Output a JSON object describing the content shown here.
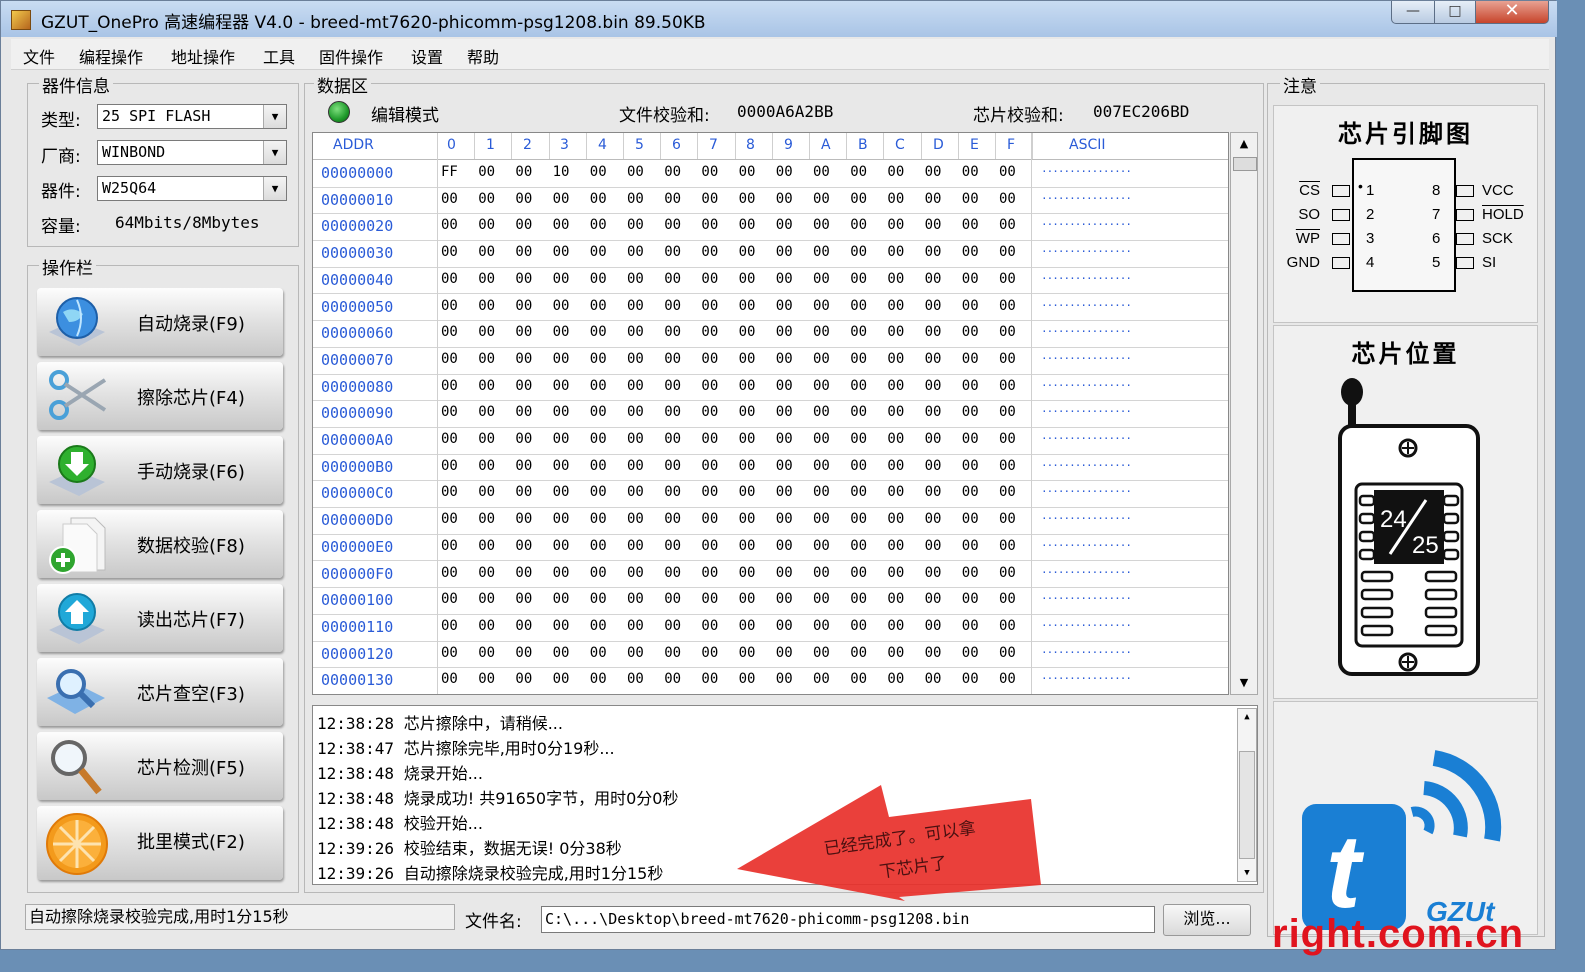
{
  "window": {
    "title": "GZUT_OnePro 高速编程器 V4.0 - breed-mt7620-phicomm-psg1208.bin  89.50KB",
    "btn_min": "—",
    "btn_max": "□",
    "btn_close": "✕"
  },
  "menu": [
    "文件",
    "编程操作",
    "地址操作",
    "工具",
    "固件操作",
    "设置",
    "帮助"
  ],
  "device_info": {
    "group_label": "器件信息",
    "type_label": "类型:",
    "type_value": "25 SPI FLASH",
    "vendor_label": "厂商:",
    "vendor_value": "WINBOND",
    "device_label": "器件:",
    "device_value": "W25Q64",
    "capacity_label": "容量:",
    "capacity_value": "64Mbits/8Mbytes"
  },
  "operations": {
    "group_label": "操作栏",
    "buttons": [
      {
        "label": "自动烧录(F9)",
        "icon": "globe-icon"
      },
      {
        "label": "擦除芯片(F4)",
        "icon": "scissors-icon"
      },
      {
        "label": "手动烧录(F6)",
        "icon": "download-arrow-icon"
      },
      {
        "label": "数据校验(F8)",
        "icon": "document-add-icon"
      },
      {
        "label": "读出芯片(F7)",
        "icon": "upload-arrow-icon"
      },
      {
        "label": "芯片查空(F3)",
        "icon": "magnifier-book-icon"
      },
      {
        "label": "芯片检测(F5)",
        "icon": "magnifier-icon"
      },
      {
        "label": "批里模式(F2)",
        "icon": "orange-slice-icon"
      }
    ]
  },
  "data_area": {
    "group_label": "数据区",
    "mode_label": "编辑模式",
    "file_checksum_label": "文件校验和:",
    "file_checksum_value": "0000A6A2BB",
    "chip_checksum_label": "芯片校验和:",
    "chip_checksum_value": "007EC206BD",
    "headers": [
      "ADDR",
      "0",
      "1",
      "2",
      "3",
      "4",
      "5",
      "6",
      "7",
      "8",
      "9",
      "A",
      "B",
      "C",
      "D",
      "E",
      "F",
      "ASCII"
    ],
    "rows": [
      {
        "addr": "00000000",
        "bytes": [
          "FF",
          "00",
          "00",
          "10",
          "00",
          "00",
          "00",
          "00",
          "00",
          "00",
          "00",
          "00",
          "00",
          "00",
          "00",
          "00"
        ],
        "ascii": "................"
      },
      {
        "addr": "00000010",
        "bytes": [
          "00",
          "00",
          "00",
          "00",
          "00",
          "00",
          "00",
          "00",
          "00",
          "00",
          "00",
          "00",
          "00",
          "00",
          "00",
          "00"
        ],
        "ascii": "................"
      },
      {
        "addr": "00000020",
        "bytes": [
          "00",
          "00",
          "00",
          "00",
          "00",
          "00",
          "00",
          "00",
          "00",
          "00",
          "00",
          "00",
          "00",
          "00",
          "00",
          "00"
        ],
        "ascii": "................"
      },
      {
        "addr": "00000030",
        "bytes": [
          "00",
          "00",
          "00",
          "00",
          "00",
          "00",
          "00",
          "00",
          "00",
          "00",
          "00",
          "00",
          "00",
          "00",
          "00",
          "00"
        ],
        "ascii": "................"
      },
      {
        "addr": "00000040",
        "bytes": [
          "00",
          "00",
          "00",
          "00",
          "00",
          "00",
          "00",
          "00",
          "00",
          "00",
          "00",
          "00",
          "00",
          "00",
          "00",
          "00"
        ],
        "ascii": "................"
      },
      {
        "addr": "00000050",
        "bytes": [
          "00",
          "00",
          "00",
          "00",
          "00",
          "00",
          "00",
          "00",
          "00",
          "00",
          "00",
          "00",
          "00",
          "00",
          "00",
          "00"
        ],
        "ascii": "................"
      },
      {
        "addr": "00000060",
        "bytes": [
          "00",
          "00",
          "00",
          "00",
          "00",
          "00",
          "00",
          "00",
          "00",
          "00",
          "00",
          "00",
          "00",
          "00",
          "00",
          "00"
        ],
        "ascii": "................"
      },
      {
        "addr": "00000070",
        "bytes": [
          "00",
          "00",
          "00",
          "00",
          "00",
          "00",
          "00",
          "00",
          "00",
          "00",
          "00",
          "00",
          "00",
          "00",
          "00",
          "00"
        ],
        "ascii": "................"
      },
      {
        "addr": "00000080",
        "bytes": [
          "00",
          "00",
          "00",
          "00",
          "00",
          "00",
          "00",
          "00",
          "00",
          "00",
          "00",
          "00",
          "00",
          "00",
          "00",
          "00"
        ],
        "ascii": "................"
      },
      {
        "addr": "00000090",
        "bytes": [
          "00",
          "00",
          "00",
          "00",
          "00",
          "00",
          "00",
          "00",
          "00",
          "00",
          "00",
          "00",
          "00",
          "00",
          "00",
          "00"
        ],
        "ascii": "................"
      },
      {
        "addr": "000000A0",
        "bytes": [
          "00",
          "00",
          "00",
          "00",
          "00",
          "00",
          "00",
          "00",
          "00",
          "00",
          "00",
          "00",
          "00",
          "00",
          "00",
          "00"
        ],
        "ascii": "................"
      },
      {
        "addr": "000000B0",
        "bytes": [
          "00",
          "00",
          "00",
          "00",
          "00",
          "00",
          "00",
          "00",
          "00",
          "00",
          "00",
          "00",
          "00",
          "00",
          "00",
          "00"
        ],
        "ascii": "................"
      },
      {
        "addr": "000000C0",
        "bytes": [
          "00",
          "00",
          "00",
          "00",
          "00",
          "00",
          "00",
          "00",
          "00",
          "00",
          "00",
          "00",
          "00",
          "00",
          "00",
          "00"
        ],
        "ascii": "................"
      },
      {
        "addr": "000000D0",
        "bytes": [
          "00",
          "00",
          "00",
          "00",
          "00",
          "00",
          "00",
          "00",
          "00",
          "00",
          "00",
          "00",
          "00",
          "00",
          "00",
          "00"
        ],
        "ascii": "................"
      },
      {
        "addr": "000000E0",
        "bytes": [
          "00",
          "00",
          "00",
          "00",
          "00",
          "00",
          "00",
          "00",
          "00",
          "00",
          "00",
          "00",
          "00",
          "00",
          "00",
          "00"
        ],
        "ascii": "................"
      },
      {
        "addr": "000000F0",
        "bytes": [
          "00",
          "00",
          "00",
          "00",
          "00",
          "00",
          "00",
          "00",
          "00",
          "00",
          "00",
          "00",
          "00",
          "00",
          "00",
          "00"
        ],
        "ascii": "................"
      },
      {
        "addr": "00000100",
        "bytes": [
          "00",
          "00",
          "00",
          "00",
          "00",
          "00",
          "00",
          "00",
          "00",
          "00",
          "00",
          "00",
          "00",
          "00",
          "00",
          "00"
        ],
        "ascii": "................"
      },
      {
        "addr": "00000110",
        "bytes": [
          "00",
          "00",
          "00",
          "00",
          "00",
          "00",
          "00",
          "00",
          "00",
          "00",
          "00",
          "00",
          "00",
          "00",
          "00",
          "00"
        ],
        "ascii": "................"
      },
      {
        "addr": "00000120",
        "bytes": [
          "00",
          "00",
          "00",
          "00",
          "00",
          "00",
          "00",
          "00",
          "00",
          "00",
          "00",
          "00",
          "00",
          "00",
          "00",
          "00"
        ],
        "ascii": "................"
      },
      {
        "addr": "00000130",
        "bytes": [
          "00",
          "00",
          "00",
          "00",
          "00",
          "00",
          "00",
          "00",
          "00",
          "00",
          "00",
          "00",
          "00",
          "00",
          "00",
          "00"
        ],
        "ascii": "................"
      }
    ]
  },
  "log": [
    {
      "time": "12:38:28",
      "msg": "芯片擦除中，请稍候..."
    },
    {
      "time": "12:38:47",
      "msg": "芯片擦除完毕,用时0分19秒..."
    },
    {
      "time": "12:38:48",
      "msg": "烧录开始..."
    },
    {
      "time": "12:38:48",
      "msg": "烧录成功! 共91650字节，用时0分0秒"
    },
    {
      "time": "12:38:48",
      "msg": "校验开始..."
    },
    {
      "time": "12:39:26",
      "msg": "校验结束，数据无误! 0分38秒"
    },
    {
      "time": "12:39:26",
      "msg": "自动擦除烧录校验完成,用时1分15秒"
    }
  ],
  "annotation": {
    "line1": "已经完成了。可以拿",
    "line2": "下芯片了",
    "color": "#e8302a"
  },
  "status_text": "自动擦除烧录校验完成,用时1分15秒",
  "file": {
    "label": "文件名:",
    "value": "C:\\...\\Desktop\\breed-mt7620-phicomm-psg1208.bin",
    "browse": "浏览..."
  },
  "notes": {
    "group_label": "注意",
    "pinout_title": "芯片引脚图",
    "pins_left": [
      {
        "name": "CS",
        "num": "1"
      },
      {
        "name": "SO",
        "num": "2"
      },
      {
        "name": "WP",
        "num": "3"
      },
      {
        "name": "GND",
        "num": "4"
      }
    ],
    "pins_right": [
      {
        "name": "VCC",
        "num": "8"
      },
      {
        "name": "HOLD",
        "num": "7"
      },
      {
        "name": "SCK",
        "num": "6"
      },
      {
        "name": "SI",
        "num": "5"
      }
    ],
    "position_title": "芯片位置",
    "chip_label_top": "24",
    "chip_label_bottom": "25",
    "logo_letter": "t",
    "logo_text": "GZUt"
  },
  "watermark": "right.com.cn",
  "colors": {
    "accent_blue": "#2a5bd7",
    "logo_blue": "#1a7fd4",
    "watermark_red": "#e0141e",
    "mode_led": "#1f9a2b"
  }
}
